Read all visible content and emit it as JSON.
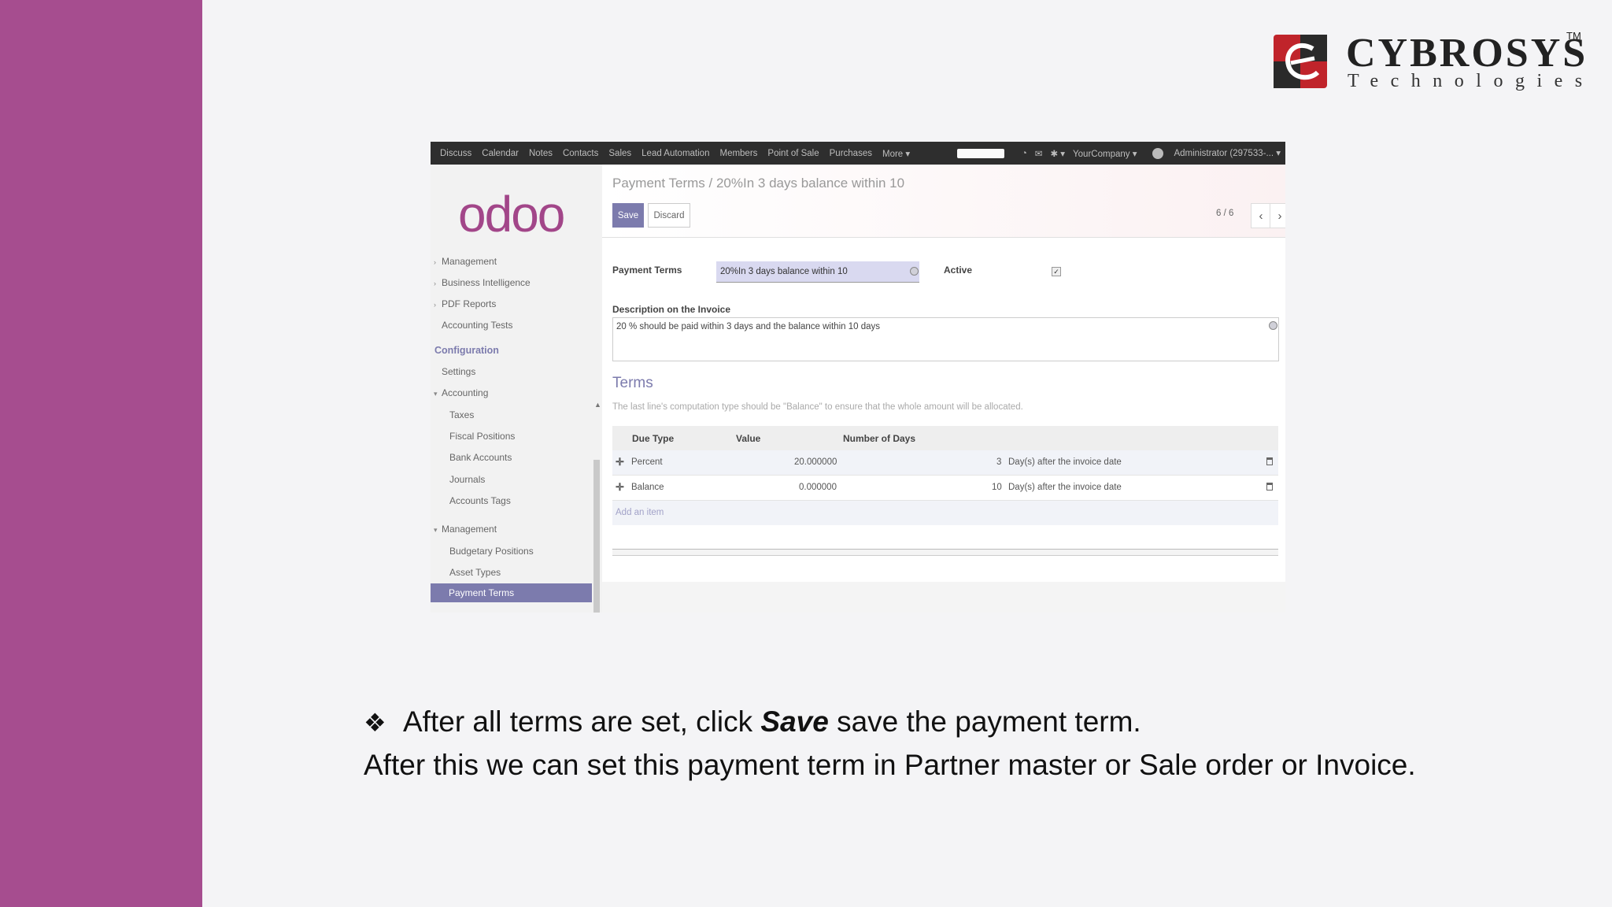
{
  "brand": {
    "name": "CYBROSYS",
    "tm": "TM",
    "tagline": "Technologies",
    "colors": {
      "mark": "#c0242b",
      "dark": "#222222"
    }
  },
  "colors": {
    "side_bar": "#a64d8f",
    "odoo_accent": "#7c7bad"
  },
  "topnav": {
    "menu": [
      "Discuss",
      "Calendar",
      "Notes",
      "Contacts",
      "Sales",
      "Lead Automation",
      "Members",
      "Point of Sale",
      "Purchases",
      "More ▾"
    ],
    "company": "YourCompany ▾",
    "user": "Administrator (297533-... ▾"
  },
  "sidebar": {
    "logo": "odoo",
    "items_top": [
      "Management",
      "Business Intelligence",
      "PDF Reports",
      "Accounting Tests"
    ],
    "config_heading": "Configuration",
    "settings": "Settings",
    "accounting": "Accounting",
    "accounting_items": [
      "Taxes",
      "Fiscal Positions",
      "Bank Accounts",
      "Journals",
      "Accounts Tags"
    ],
    "management": "Management",
    "management_items": [
      "Budgetary Positions",
      "Asset Types",
      "Payment Terms"
    ]
  },
  "form": {
    "breadcrumb_parent": "Payment Terms /",
    "breadcrumb_current": "20%In 3 days balance within 10",
    "save_label": "Save",
    "discard_label": "Discard",
    "pager": "6 / 6",
    "payment_terms_label": "Payment Terms",
    "payment_terms_value": "20%In 3 days balance within 10",
    "active_label": "Active",
    "active_checked": true,
    "description_label": "Description on the Invoice",
    "description_value": "20 % should be paid within 3 days and the balance within 10 days",
    "terms_title": "Terms",
    "terms_help": "The last line's computation type should be \"Balance\" to ensure that the whole amount will be allocated.",
    "table": {
      "headers": [
        "Due Type",
        "Value",
        "Number of Days"
      ],
      "rows": [
        {
          "due_type": "Percent",
          "value": "20.000000",
          "days": "3",
          "option": "Day(s) after the invoice date"
        },
        {
          "due_type": "Balance",
          "value": "0.000000",
          "days": "10",
          "option": "Day(s) after the invoice date"
        }
      ],
      "add_item": "Add an item"
    }
  },
  "caption": {
    "bullet": "❖",
    "line1_pre": "After all terms are set, click ",
    "line1_em": "Save",
    "line1_post": " save the payment term.",
    "line2": "After this we can set this payment term in  Partner master or Sale order or Invoice."
  }
}
